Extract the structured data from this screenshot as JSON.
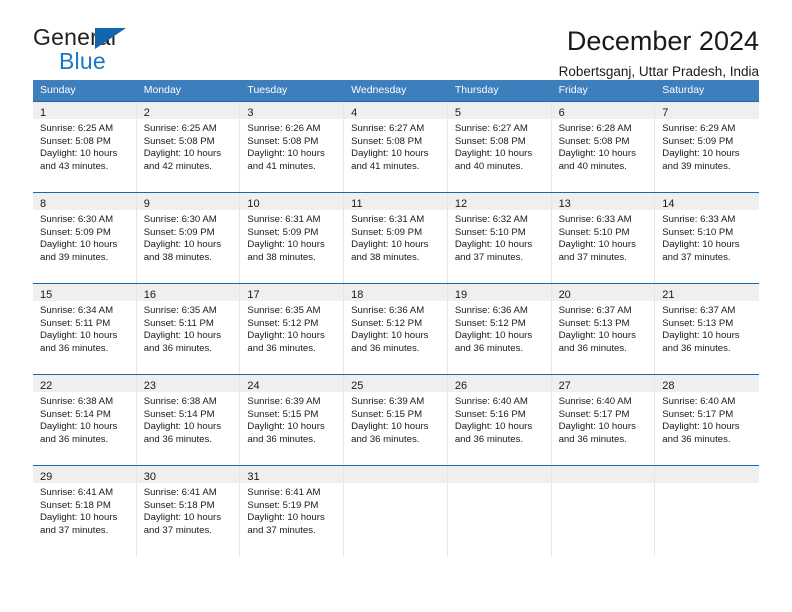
{
  "logo": {
    "word_top": "General",
    "word_bottom": "Blue",
    "triangle_color": "#1166ad",
    "blue_color": "#1878c4",
    "icon": "triangle-icon"
  },
  "header": {
    "title": "December 2024",
    "subtitle": "Robertsganj, Uttar Pradesh, India"
  },
  "theme": {
    "header_row_bg": "#3d7ebd",
    "week_divider": "#1b69ad",
    "daynum_band_bg": "#efefef",
    "text": "#1a1a1a"
  },
  "calendar": {
    "weekdays": [
      "Sunday",
      "Monday",
      "Tuesday",
      "Wednesday",
      "Thursday",
      "Friday",
      "Saturday"
    ],
    "labels": {
      "sunrise": "Sunrise:",
      "sunset": "Sunset:",
      "daylight": "Daylight:"
    },
    "weeks": [
      [
        {
          "day": "1",
          "sunrise": "Sunrise: 6:25 AM",
          "sunset": "Sunset: 5:08 PM",
          "daylight1": "Daylight: 10 hours",
          "daylight2": "and 43 minutes."
        },
        {
          "day": "2",
          "sunrise": "Sunrise: 6:25 AM",
          "sunset": "Sunset: 5:08 PM",
          "daylight1": "Daylight: 10 hours",
          "daylight2": "and 42 minutes."
        },
        {
          "day": "3",
          "sunrise": "Sunrise: 6:26 AM",
          "sunset": "Sunset: 5:08 PM",
          "daylight1": "Daylight: 10 hours",
          "daylight2": "and 41 minutes."
        },
        {
          "day": "4",
          "sunrise": "Sunrise: 6:27 AM",
          "sunset": "Sunset: 5:08 PM",
          "daylight1": "Daylight: 10 hours",
          "daylight2": "and 41 minutes."
        },
        {
          "day": "5",
          "sunrise": "Sunrise: 6:27 AM",
          "sunset": "Sunset: 5:08 PM",
          "daylight1": "Daylight: 10 hours",
          "daylight2": "and 40 minutes."
        },
        {
          "day": "6",
          "sunrise": "Sunrise: 6:28 AM",
          "sunset": "Sunset: 5:08 PM",
          "daylight1": "Daylight: 10 hours",
          "daylight2": "and 40 minutes."
        },
        {
          "day": "7",
          "sunrise": "Sunrise: 6:29 AM",
          "sunset": "Sunset: 5:09 PM",
          "daylight1": "Daylight: 10 hours",
          "daylight2": "and 39 minutes."
        }
      ],
      [
        {
          "day": "8",
          "sunrise": "Sunrise: 6:30 AM",
          "sunset": "Sunset: 5:09 PM",
          "daylight1": "Daylight: 10 hours",
          "daylight2": "and 39 minutes."
        },
        {
          "day": "9",
          "sunrise": "Sunrise: 6:30 AM",
          "sunset": "Sunset: 5:09 PM",
          "daylight1": "Daylight: 10 hours",
          "daylight2": "and 38 minutes."
        },
        {
          "day": "10",
          "sunrise": "Sunrise: 6:31 AM",
          "sunset": "Sunset: 5:09 PM",
          "daylight1": "Daylight: 10 hours",
          "daylight2": "and 38 minutes."
        },
        {
          "day": "11",
          "sunrise": "Sunrise: 6:31 AM",
          "sunset": "Sunset: 5:09 PM",
          "daylight1": "Daylight: 10 hours",
          "daylight2": "and 38 minutes."
        },
        {
          "day": "12",
          "sunrise": "Sunrise: 6:32 AM",
          "sunset": "Sunset: 5:10 PM",
          "daylight1": "Daylight: 10 hours",
          "daylight2": "and 37 minutes."
        },
        {
          "day": "13",
          "sunrise": "Sunrise: 6:33 AM",
          "sunset": "Sunset: 5:10 PM",
          "daylight1": "Daylight: 10 hours",
          "daylight2": "and 37 minutes."
        },
        {
          "day": "14",
          "sunrise": "Sunrise: 6:33 AM",
          "sunset": "Sunset: 5:10 PM",
          "daylight1": "Daylight: 10 hours",
          "daylight2": "and 37 minutes."
        }
      ],
      [
        {
          "day": "15",
          "sunrise": "Sunrise: 6:34 AM",
          "sunset": "Sunset: 5:11 PM",
          "daylight1": "Daylight: 10 hours",
          "daylight2": "and 36 minutes."
        },
        {
          "day": "16",
          "sunrise": "Sunrise: 6:35 AM",
          "sunset": "Sunset: 5:11 PM",
          "daylight1": "Daylight: 10 hours",
          "daylight2": "and 36 minutes."
        },
        {
          "day": "17",
          "sunrise": "Sunrise: 6:35 AM",
          "sunset": "Sunset: 5:12 PM",
          "daylight1": "Daylight: 10 hours",
          "daylight2": "and 36 minutes."
        },
        {
          "day": "18",
          "sunrise": "Sunrise: 6:36 AM",
          "sunset": "Sunset: 5:12 PM",
          "daylight1": "Daylight: 10 hours",
          "daylight2": "and 36 minutes."
        },
        {
          "day": "19",
          "sunrise": "Sunrise: 6:36 AM",
          "sunset": "Sunset: 5:12 PM",
          "daylight1": "Daylight: 10 hours",
          "daylight2": "and 36 minutes."
        },
        {
          "day": "20",
          "sunrise": "Sunrise: 6:37 AM",
          "sunset": "Sunset: 5:13 PM",
          "daylight1": "Daylight: 10 hours",
          "daylight2": "and 36 minutes."
        },
        {
          "day": "21",
          "sunrise": "Sunrise: 6:37 AM",
          "sunset": "Sunset: 5:13 PM",
          "daylight1": "Daylight: 10 hours",
          "daylight2": "and 36 minutes."
        }
      ],
      [
        {
          "day": "22",
          "sunrise": "Sunrise: 6:38 AM",
          "sunset": "Sunset: 5:14 PM",
          "daylight1": "Daylight: 10 hours",
          "daylight2": "and 36 minutes."
        },
        {
          "day": "23",
          "sunrise": "Sunrise: 6:38 AM",
          "sunset": "Sunset: 5:14 PM",
          "daylight1": "Daylight: 10 hours",
          "daylight2": "and 36 minutes."
        },
        {
          "day": "24",
          "sunrise": "Sunrise: 6:39 AM",
          "sunset": "Sunset: 5:15 PM",
          "daylight1": "Daylight: 10 hours",
          "daylight2": "and 36 minutes."
        },
        {
          "day": "25",
          "sunrise": "Sunrise: 6:39 AM",
          "sunset": "Sunset: 5:15 PM",
          "daylight1": "Daylight: 10 hours",
          "daylight2": "and 36 minutes."
        },
        {
          "day": "26",
          "sunrise": "Sunrise: 6:40 AM",
          "sunset": "Sunset: 5:16 PM",
          "daylight1": "Daylight: 10 hours",
          "daylight2": "and 36 minutes."
        },
        {
          "day": "27",
          "sunrise": "Sunrise: 6:40 AM",
          "sunset": "Sunset: 5:17 PM",
          "daylight1": "Daylight: 10 hours",
          "daylight2": "and 36 minutes."
        },
        {
          "day": "28",
          "sunrise": "Sunrise: 6:40 AM",
          "sunset": "Sunset: 5:17 PM",
          "daylight1": "Daylight: 10 hours",
          "daylight2": "and 36 minutes."
        }
      ],
      [
        {
          "day": "29",
          "sunrise": "Sunrise: 6:41 AM",
          "sunset": "Sunset: 5:18 PM",
          "daylight1": "Daylight: 10 hours",
          "daylight2": "and 37 minutes."
        },
        {
          "day": "30",
          "sunrise": "Sunrise: 6:41 AM",
          "sunset": "Sunset: 5:18 PM",
          "daylight1": "Daylight: 10 hours",
          "daylight2": "and 37 minutes."
        },
        {
          "day": "31",
          "sunrise": "Sunrise: 6:41 AM",
          "sunset": "Sunset: 5:19 PM",
          "daylight1": "Daylight: 10 hours",
          "daylight2": "and 37 minutes."
        },
        {
          "day": "",
          "sunrise": "",
          "sunset": "",
          "daylight1": "",
          "daylight2": ""
        },
        {
          "day": "",
          "sunrise": "",
          "sunset": "",
          "daylight1": "",
          "daylight2": ""
        },
        {
          "day": "",
          "sunrise": "",
          "sunset": "",
          "daylight1": "",
          "daylight2": ""
        },
        {
          "day": "",
          "sunrise": "",
          "sunset": "",
          "daylight1": "",
          "daylight2": ""
        }
      ]
    ]
  }
}
